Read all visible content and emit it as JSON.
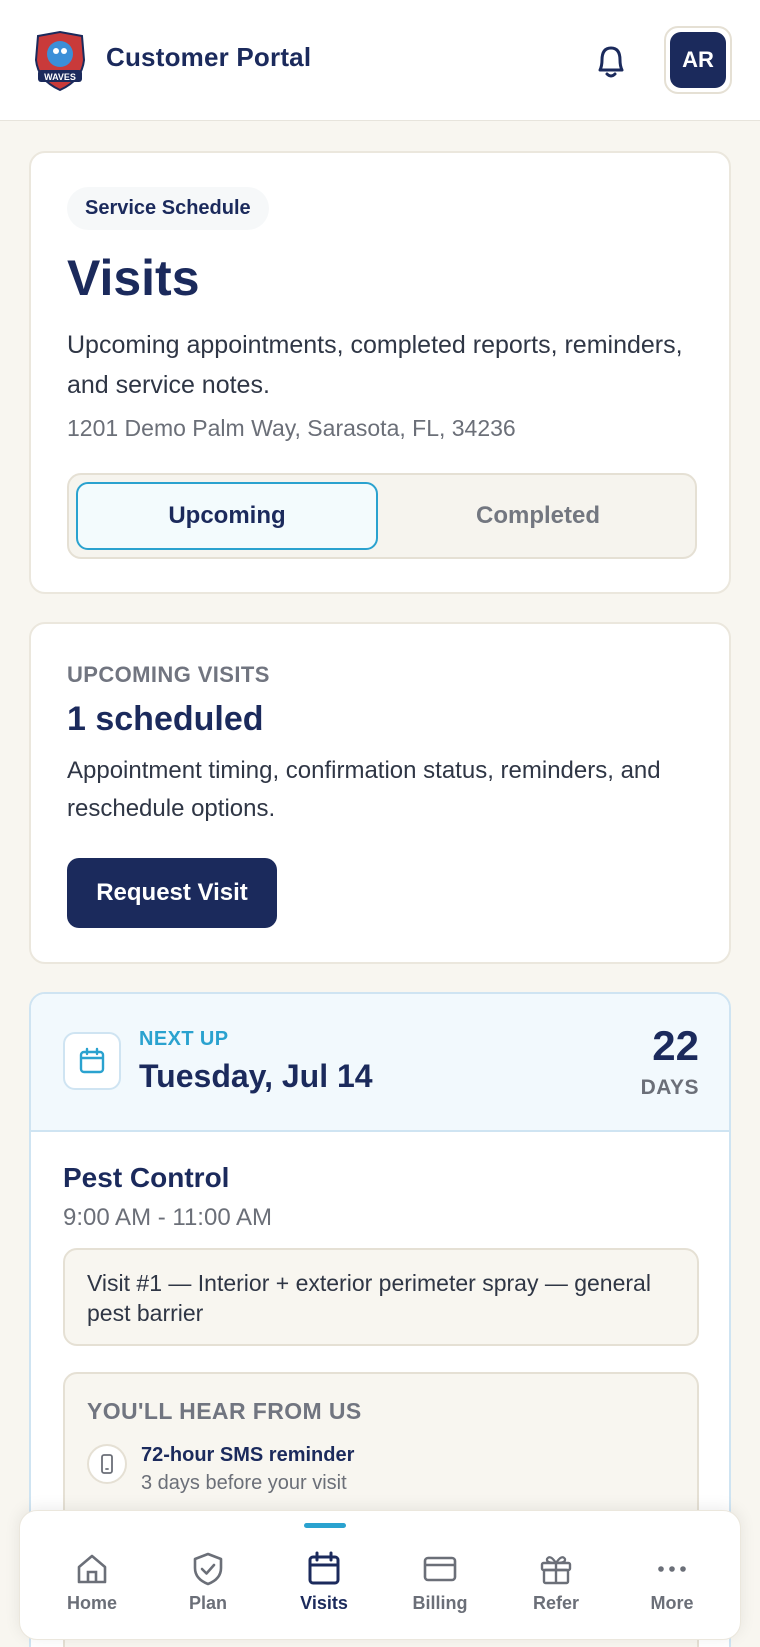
{
  "header": {
    "title": "Customer Portal",
    "logo_text": "WAVES",
    "avatar_initials": "AR"
  },
  "schedule": {
    "pill": "Service Schedule",
    "title": "Visits",
    "description": "Upcoming appointments, completed reports, reminders, and service notes.",
    "address": "1201 Demo Palm Way, Sarasota, FL, 34236",
    "tabs": [
      {
        "label": "Upcoming",
        "active": true
      },
      {
        "label": "Completed",
        "active": false
      }
    ]
  },
  "upcoming": {
    "eyebrow": "UPCOMING VISITS",
    "count": "1 scheduled",
    "description": "Appointment timing, confirmation status, reminders, and reschedule options.",
    "request_label": "Request Visit"
  },
  "next_visit": {
    "label": "NEXT UP",
    "date": "Tuesday, Jul 14",
    "days_number": "22",
    "days_label": "DAYS",
    "service": "Pest Control",
    "time": "9:00 AM - 11:00 AM",
    "note": "Visit #1 — Interior + exterior perimeter spray — general pest barrier",
    "hear_title": "YOU'LL HEAR FROM US",
    "reminders": [
      {
        "title": "72-hour SMS reminder",
        "subtitle": "3 days before your visit"
      }
    ]
  },
  "nav": {
    "items": [
      {
        "label": "Home",
        "icon": "home-icon"
      },
      {
        "label": "Plan",
        "icon": "shield-icon"
      },
      {
        "label": "Visits",
        "icon": "calendar-icon",
        "active": true
      },
      {
        "label": "Billing",
        "icon": "card-icon"
      },
      {
        "label": "Refer",
        "icon": "gift-icon"
      },
      {
        "label": "More",
        "icon": "more-icon"
      }
    ]
  },
  "colors": {
    "navy": "#1b2a5c",
    "accent": "#2aa2cf",
    "background": "#f8f6f0"
  }
}
